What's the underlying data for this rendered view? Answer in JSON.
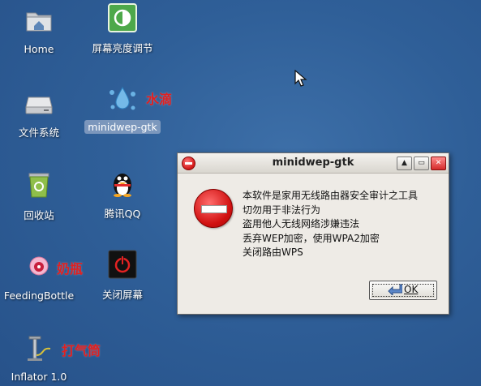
{
  "desktop": {
    "icons": [
      {
        "label": "Home"
      },
      {
        "label": "屏幕亮度调节"
      },
      {
        "label": "文件系统"
      },
      {
        "label": "minidwep-gtk"
      },
      {
        "label": "回收站"
      },
      {
        "label": "腾讯QQ"
      },
      {
        "label": "FeedingBottle"
      },
      {
        "label": "关闭屏幕"
      },
      {
        "label": "Inflator 1.0"
      }
    ],
    "annotations": {
      "water_drop": "水滴",
      "feeding_bottle": "奶瓶",
      "inflator": "打气筒"
    }
  },
  "dialog": {
    "title": "minidwep-gtk",
    "messages": [
      "本软件是家用无线路由器安全审计之工具",
      "切勿用于非法行为",
      "盗用他人无线网络涉嫌违法",
      "丢弃WEP加密，使用WPA2加密",
      "关闭路由WPS"
    ],
    "ok_label": "OK",
    "buttons": {
      "maximize": "▲",
      "restore": "▭",
      "close": "✕"
    }
  },
  "colors": {
    "annotation_red": "#e02020",
    "dialog_bg": "#eeebe6"
  }
}
